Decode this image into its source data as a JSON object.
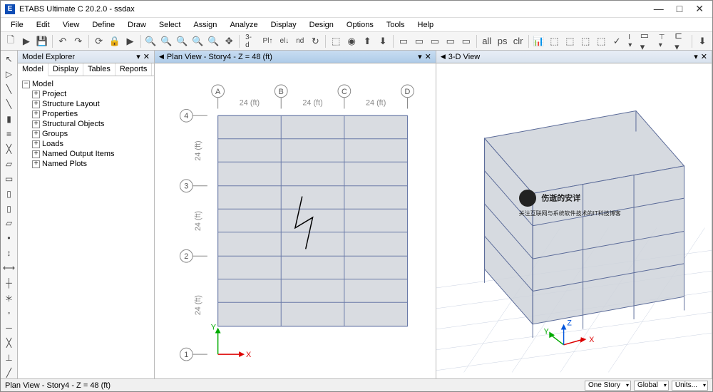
{
  "window": {
    "title": "ETABS Ultimate C 20.2.0 - ssdax",
    "app_icon_letter": "E"
  },
  "menu": [
    "File",
    "Edit",
    "View",
    "Define",
    "Draw",
    "Select",
    "Assign",
    "Analyze",
    "Display",
    "Design",
    "Options",
    "Tools",
    "Help"
  ],
  "toolbar_3d_label": "3-d",
  "explorer": {
    "title": "Model Explorer",
    "tabs": [
      "Model",
      "Display",
      "Tables",
      "Reports"
    ],
    "active_tab": "Model",
    "root": "Model",
    "items": [
      "Project",
      "Structure Layout",
      "Properties",
      "Structural Objects",
      "Groups",
      "Loads",
      "Named Output Items",
      "Named Plots"
    ]
  },
  "plan_view": {
    "title": "Plan View - Story4 - Z = 48 (ft)",
    "grid_cols": [
      "A",
      "B",
      "C",
      "D"
    ],
    "grid_rows": [
      "4",
      "3",
      "2",
      "1"
    ],
    "span_label": "24 (ft)",
    "axis_x": "X",
    "axis_y": "Y"
  },
  "view3d": {
    "title": "3-D View",
    "watermark_main": "伤逝的安详",
    "watermark_sub": "关注互联网与系统软件技术的IT科技博客",
    "axis_x": "X",
    "axis_y": "Y",
    "axis_z": "Z"
  },
  "statusbar": {
    "left": "Plan View - Story4 - Z = 48 (ft)",
    "combo1": "One Story",
    "combo2": "Global",
    "units_btn": "Units..."
  }
}
